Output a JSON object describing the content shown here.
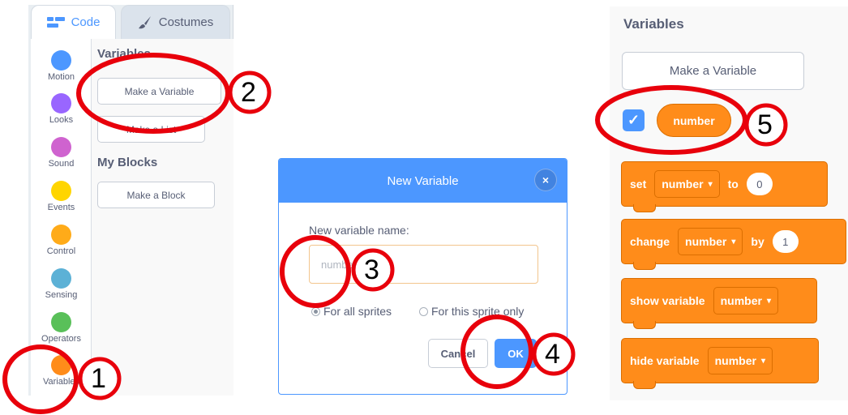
{
  "editor": {
    "tabs": [
      {
        "label": "Code",
        "icon": "code-icon"
      },
      {
        "label": "Costumes",
        "icon": "brush-icon"
      }
    ],
    "categories": [
      {
        "label": "Motion",
        "color": "#4c97ff"
      },
      {
        "label": "Looks",
        "color": "#9966ff"
      },
      {
        "label": "Sound",
        "color": "#cf63cf"
      },
      {
        "label": "Events",
        "color": "#ffd500"
      },
      {
        "label": "Control",
        "color": "#ffab19"
      },
      {
        "label": "Sensing",
        "color": "#5cb1d6"
      },
      {
        "label": "Operators",
        "color": "#59c059"
      },
      {
        "label": "Variables",
        "color": "#ff8c1a"
      }
    ],
    "palette": {
      "variables_heading": "Variables",
      "make_variable": "Make a Variable",
      "make_list": "Make a List",
      "my_blocks_heading": "My Blocks",
      "make_block": "Make a Block"
    }
  },
  "dialog": {
    "title": "New Variable",
    "close_symbol": "×",
    "name_label": "New variable name:",
    "name_value": "number",
    "options": [
      {
        "label": "For all sprites",
        "selected": true
      },
      {
        "label": "For this sprite only",
        "selected": false
      }
    ],
    "cancel_label": "Cancel",
    "ok_label": "OK"
  },
  "blocks_panel": {
    "title": "Variables",
    "make_variable": "Make a Variable",
    "checkbox_symbol": "✓",
    "reporter": "number",
    "set": {
      "kw": "set",
      "var": "number",
      "to": "to",
      "value": "0"
    },
    "change": {
      "kw": "change",
      "var": "number",
      "by": "by",
      "value": "1"
    },
    "show": {
      "kw": "show variable",
      "var": "number"
    },
    "hide": {
      "kw": "hide variable",
      "var": "number"
    },
    "caret": "▾"
  },
  "annotations": {
    "color": "#e8000b",
    "steps": [
      "1",
      "2",
      "3",
      "4",
      "5"
    ]
  }
}
